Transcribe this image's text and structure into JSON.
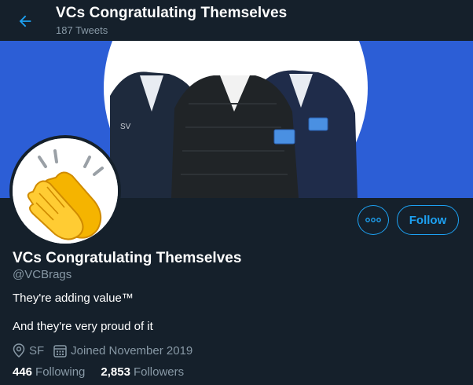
{
  "header": {
    "title": "VCs Congratulating Themselves",
    "tweet_count": "187 Tweets",
    "back_icon": "arrow-left-icon"
  },
  "banner": {
    "background_color": "#2c5ed6",
    "description_icon": "three-silhouettes-in-vests"
  },
  "avatar": {
    "emoji": "clapping-hands-icon"
  },
  "actions": {
    "more_icon": "more-dots-icon",
    "follow_label": "Follow"
  },
  "profile": {
    "name": "VCs Congratulating Themselves",
    "handle": "@VCBrags",
    "bio_line1": "They're adding value™",
    "bio_line2": "And they're very proud of it",
    "location": "SF",
    "joined": "Joined November 2019",
    "location_icon": "location-pin-icon",
    "calendar_icon": "calendar-icon"
  },
  "stats": {
    "following_count": "446",
    "following_label": "Following",
    "followers_count": "2,853",
    "followers_label": "Followers"
  },
  "colors": {
    "background": "#15202b",
    "accent": "#1da1f2",
    "secondary_text": "#8899a6"
  }
}
